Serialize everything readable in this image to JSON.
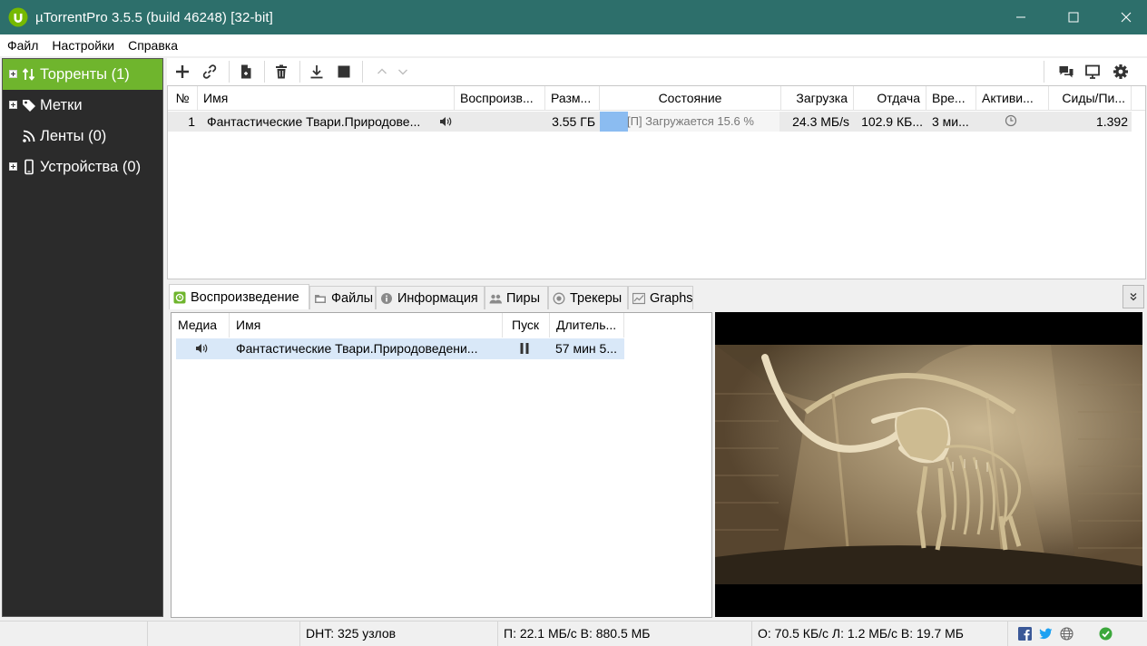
{
  "window": {
    "title": "µTorrentPro 3.5.5  (build 46248) [32-bit]",
    "minimize_glyph": "minimize-icon",
    "maximize_glyph": "maximize-icon",
    "close_glyph": "close-icon"
  },
  "menu": [
    "Файл",
    "Настройки",
    "Справка"
  ],
  "sidebar": {
    "items": [
      {
        "label": "Торренты (1)",
        "icon": "torrents-arrows-icon",
        "expandable": true,
        "active": true
      },
      {
        "label": "Метки",
        "icon": "tag-icon",
        "expandable": true,
        "active": false
      },
      {
        "label": "Ленты (0)",
        "icon": "rss-icon",
        "expandable": false,
        "active": false
      },
      {
        "label": "Устройства (0)",
        "icon": "phone-icon",
        "expandable": true,
        "active": false
      }
    ]
  },
  "toolbar": {
    "left_icons": [
      "add-icon",
      "link-icon",
      "create-file-icon",
      "delete-icon",
      "download-icon",
      "stop-icon",
      "move-up-icon",
      "move-down-icon"
    ],
    "right_icons": [
      "chat-icon",
      "remote-icon",
      "settings-gear-icon"
    ]
  },
  "torrents": {
    "columns": [
      "№",
      "Имя",
      "Воспроизв...",
      "Разм...",
      "Состояние",
      "Загрузка",
      "Отдача",
      "Вре...",
      "Активи...",
      "Сиды/Пи..."
    ],
    "rows": [
      {
        "num": "1",
        "name": "Фантастические Твари.Природове...",
        "play": "speaker-icon",
        "size": "3.55 ГБ",
        "status": "[П] Загружается 15.6 %",
        "progress": 0.156,
        "down": "24.3 МБ/s",
        "up": "102.9 КБ...",
        "time": "3 ми...",
        "activity": "clock-icon",
        "seeds": "1.392"
      }
    ]
  },
  "tabs": [
    {
      "label": "Воспроизведение",
      "icon": "play-tab-icon",
      "active": true
    },
    {
      "label": "Файлы",
      "icon": "files-tab-icon",
      "active": false
    },
    {
      "label": "Информация",
      "icon": "info-tab-icon",
      "active": false
    },
    {
      "label": "Пиры",
      "icon": "peers-tab-icon",
      "active": false
    },
    {
      "label": "Трекеры",
      "icon": "trackers-tab-icon",
      "active": false
    },
    {
      "label": "Graphs",
      "icon": "graphs-tab-icon",
      "active": false
    }
  ],
  "media": {
    "columns": [
      "Медиа",
      "Имя",
      "Пуск",
      "Длитель..."
    ],
    "rows": [
      {
        "media": "speaker-icon",
        "name": "Фантастические Твари.Природоведени...",
        "play": "pause-icon",
        "duration": "57 мин 5..."
      }
    ]
  },
  "status": {
    "dht": "DHT: 325 узлов",
    "down": "П: 22.1 МБ/с В: 880.5 МБ",
    "up": "О: 70.5 КБ/с Л: 1.2 МБ/с В: 19.7 МБ",
    "icons": [
      "facebook-icon",
      "twitter-icon",
      "web-globe-icon",
      "status-ok-icon"
    ]
  },
  "colors": {
    "titlebar": "#2d6f6b",
    "sidebar_bg": "#2b2b2b",
    "sidebar_active": "#6fb52d",
    "progress_fill": "#8bbcf1",
    "media_row_selected": "#d9e8f8"
  }
}
